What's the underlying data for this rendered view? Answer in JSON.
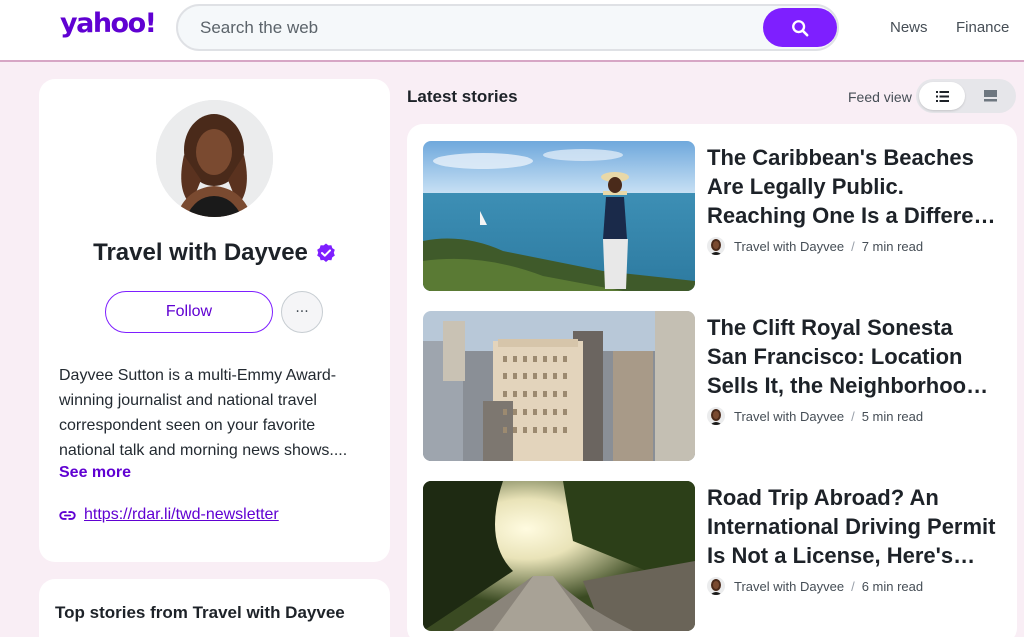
{
  "header": {
    "logo": "yahoo!",
    "search_placeholder": "Search the web",
    "nav": [
      "News",
      "Finance"
    ]
  },
  "profile": {
    "name": "Travel with Dayvee",
    "follow_label": "Follow",
    "more_label": "···",
    "bio": "Dayvee Sutton is a multi-Emmy Award-winning journalist and national travel correspondent seen on your favorite national talk and morning news shows....",
    "see_more": "See more",
    "link": "https://rdar.li/twd-newsletter"
  },
  "top_stories_heading": "Top stories from Travel with Dayvee",
  "latest": {
    "title": "Latest stories",
    "feed_view_label": "Feed view"
  },
  "stories": [
    {
      "title": "The Caribbean's Beaches Are Legally Public. Reaching One Is a Different Story",
      "author": "Travel with Dayvee",
      "read_time": "7 min read"
    },
    {
      "title": "The Clift Royal Sonesta San Francisco: Location Sells It, the Neighborhood Doesn't",
      "author": "Travel with Dayvee",
      "read_time": "5 min read"
    },
    {
      "title": "Road Trip Abroad? An International Driving Permit Is Not a License, Here's Why",
      "author": "Travel with Dayvee",
      "read_time": "6 min read"
    }
  ],
  "colors": {
    "brand": "#6001d2",
    "accent": "#7e1fff",
    "page_bg": "#f9eef5"
  },
  "icons": [
    "search-icon",
    "verified-badge-icon",
    "link-icon",
    "list-view-icon",
    "card-view-icon"
  ]
}
